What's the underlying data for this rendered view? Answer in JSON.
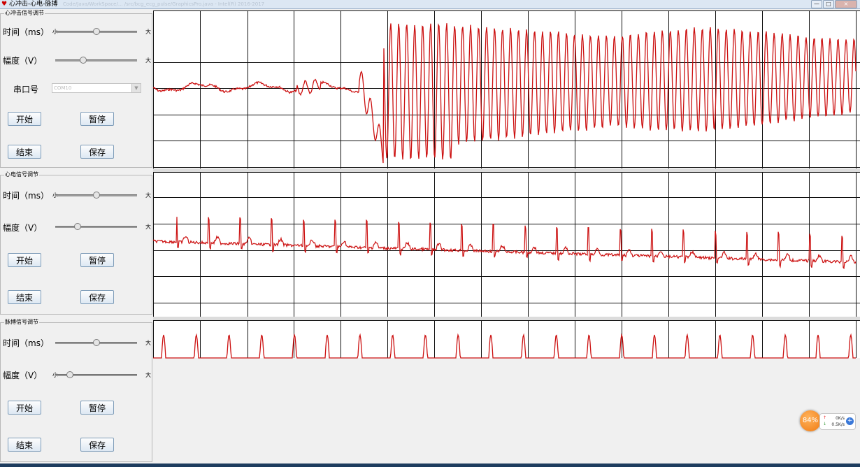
{
  "window": {
    "title": "心冲击-心电-脉搏",
    "path": "Code/Java/WorkSpace/... /src/bcg_ecg_pulse/GraphicsPro.java - Intel(R) 2016-2017",
    "controls": [
      "—",
      "□",
      "×"
    ]
  },
  "panels": [
    {
      "title": "心冲击信号调节",
      "time_label": "时间（ms）",
      "amp_label": "幅度（V）",
      "small": "小",
      "big": "大",
      "time_level": 0.5,
      "amp_level": 0.33,
      "port_label": "串口号",
      "port_value": "COM10",
      "start": "开始",
      "pause": "暂停",
      "end": "结束",
      "save": "保存"
    },
    {
      "title": "心电信号调节",
      "time_label": "时间（ms）",
      "amp_label": "幅度（V）",
      "small": "小",
      "big": "大",
      "time_level": 0.5,
      "amp_level": 0.25,
      "start": "开始",
      "pause": "暂停",
      "end": "结束",
      "save": "保存"
    },
    {
      "title": "脉搏信号调节",
      "time_label": "时间（ms）",
      "amp_label": "幅度（V）",
      "small": "小",
      "big": "大",
      "time_level": 0.5,
      "amp_level": 0.15,
      "start": "开始",
      "pause": "暂停",
      "end": "结束",
      "save": "保存"
    }
  ],
  "colors": {
    "signal": "#cc1111",
    "grid": "#111111",
    "plot_bg": "#ffffff"
  },
  "tray": {
    "cpu": "84%",
    "upload": "0K/s",
    "download": "0.5K/s"
  }
}
